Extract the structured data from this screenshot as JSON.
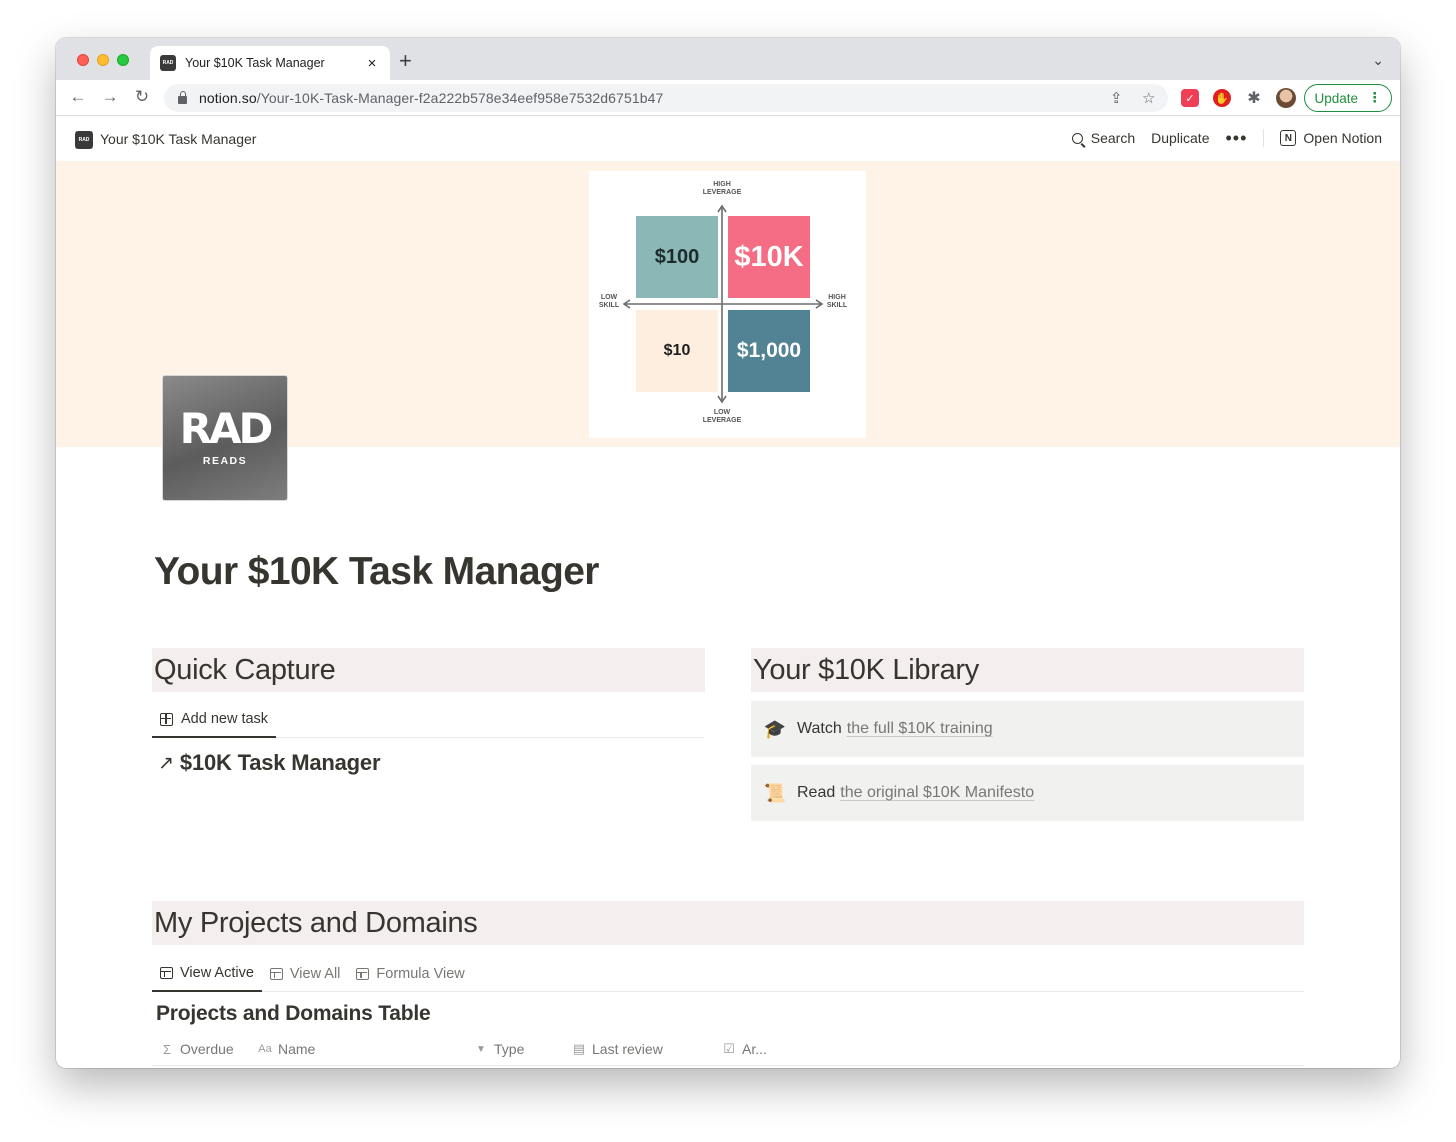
{
  "browser": {
    "tab_title": "Your $10K Task Manager",
    "tab_favicon": "RAD",
    "close_glyph": "×",
    "new_tab_glyph": "+",
    "url_host": "notion.so",
    "url_path": "/Your-10K-Task-Manager-f2a222b578e34eef958e7532d6751b47",
    "update_label": "Update"
  },
  "notion_bar": {
    "page_title": "Your $10K Task Manager",
    "search_label": "Search",
    "duplicate_label": "Duplicate",
    "open_notion_label": "Open Notion"
  },
  "cover": {
    "axis_top": [
      "HIGH",
      "LEVERAGE"
    ],
    "axis_bottom": [
      "LOW",
      "LEVERAGE"
    ],
    "axis_left": [
      "LOW",
      "SKILL"
    ],
    "axis_right": [
      "HIGH",
      "SKILL"
    ],
    "quadrants": [
      {
        "label": "$100",
        "color": "#8ab8b7",
        "text_color": "#1f2b2b"
      },
      {
        "label": "$10K",
        "color": "#f56d84",
        "text_color": "#ffffff"
      },
      {
        "label": "$10",
        "color": "#fdeee0",
        "text_color": "#1f1f1f"
      },
      {
        "label": "$1,000",
        "color": "#528395",
        "text_color": "#ffffff"
      }
    ]
  },
  "page_icon": {
    "mark": "RAD",
    "sub": "READS"
  },
  "page": {
    "title": "Your $10K Task Manager"
  },
  "quick_capture": {
    "heading": "Quick Capture",
    "add_task_label": "Add new task",
    "link_label": "$10K Task Manager"
  },
  "library": {
    "heading": "Your $10K Library",
    "items": [
      {
        "emoji": "🎓",
        "verb": "Watch",
        "link": "the full $10K training"
      },
      {
        "emoji": "📜",
        "verb": "Read",
        "link": "the original $10K Manifesto"
      }
    ]
  },
  "projects": {
    "heading": "My Projects and Domains",
    "views": [
      "View Active",
      "View All",
      "Formula View"
    ],
    "table_title": "Projects and Domains Table",
    "columns": [
      {
        "icon": "Σ",
        "label": "Overdue"
      },
      {
        "icon": "Aa",
        "label": "Name"
      },
      {
        "icon": "▼",
        "label": "Type"
      },
      {
        "icon": "▤",
        "label": "Last review"
      },
      {
        "icon": "☑",
        "label": "Ar..."
      }
    ]
  },
  "colors": {
    "accent_green": "#1e8e3e",
    "cover_bg": "#fff2e7",
    "callout_bg": "#f4eeee",
    "text": "#37352f"
  }
}
